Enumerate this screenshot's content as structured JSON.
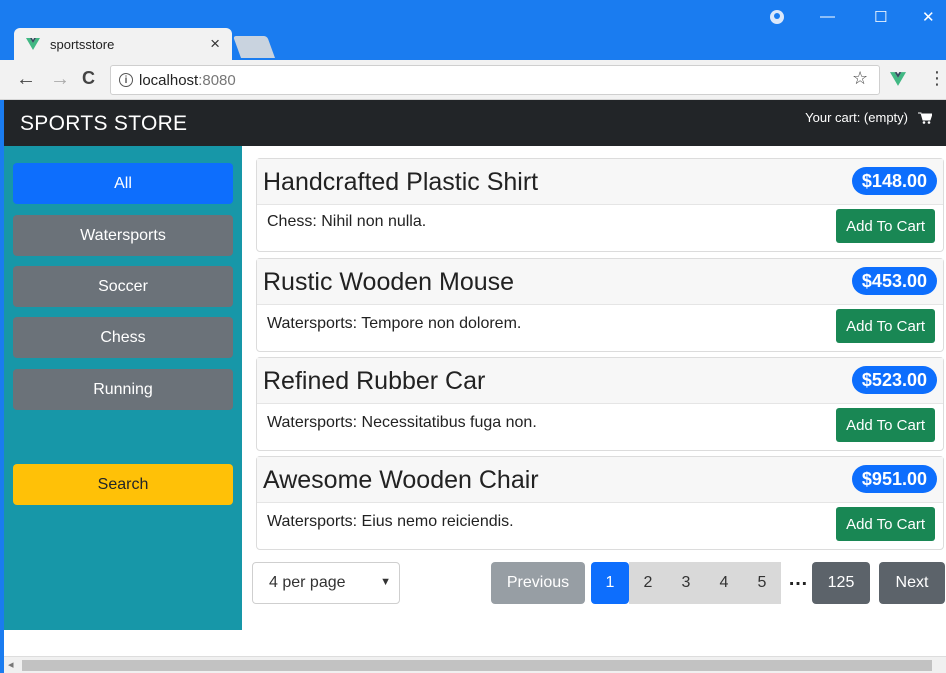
{
  "browser": {
    "tab_title": "sportsstore",
    "tab_close": "×",
    "url_host": "localhost",
    "url_port": ":8080",
    "info": "i",
    "back": "←",
    "forward": "→",
    "reload": "C",
    "star": "☆",
    "menu": "⋮",
    "minimize": "—",
    "maximize": "☐",
    "close": "✕"
  },
  "navbar": {
    "brand": "SPORTS STORE",
    "cart_text": "Your cart: (empty)"
  },
  "sidebar": {
    "categories": [
      {
        "label": "All",
        "active": true
      },
      {
        "label": "Watersports",
        "active": false
      },
      {
        "label": "Soccer",
        "active": false
      },
      {
        "label": "Chess",
        "active": false
      },
      {
        "label": "Running",
        "active": false
      }
    ],
    "search_label": "Search"
  },
  "products": [
    {
      "name": "Handcrafted Plastic Shirt",
      "price": "$148.00",
      "description": "Chess: Nihil non nulla.",
      "button": "Add To Cart"
    },
    {
      "name": "Rustic Wooden Mouse",
      "price": "$453.00",
      "description": "Watersports: Tempore non dolorem.",
      "button": "Add To Cart"
    },
    {
      "name": "Refined Rubber Car",
      "price": "$523.00",
      "description": "Watersports: Necessitatibus fuga non.",
      "button": "Add To Cart"
    },
    {
      "name": "Awesome Wooden Chair",
      "price": "$951.00",
      "description": "Watersports: Eius nemo reiciendis.",
      "button": "Add To Cart"
    }
  ],
  "pagination": {
    "page_size": "4 per page",
    "previous": "Previous",
    "pages": [
      "1",
      "2",
      "3",
      "4",
      "5"
    ],
    "ellipsis": "…",
    "last": "125",
    "next": "Next",
    "current": "1"
  },
  "colors": {
    "primary": "#0d6efd",
    "success": "#198754",
    "warning": "#ffc107",
    "secondary": "#6b7279",
    "sidebar": "#1797a8",
    "navbar": "#222528"
  }
}
